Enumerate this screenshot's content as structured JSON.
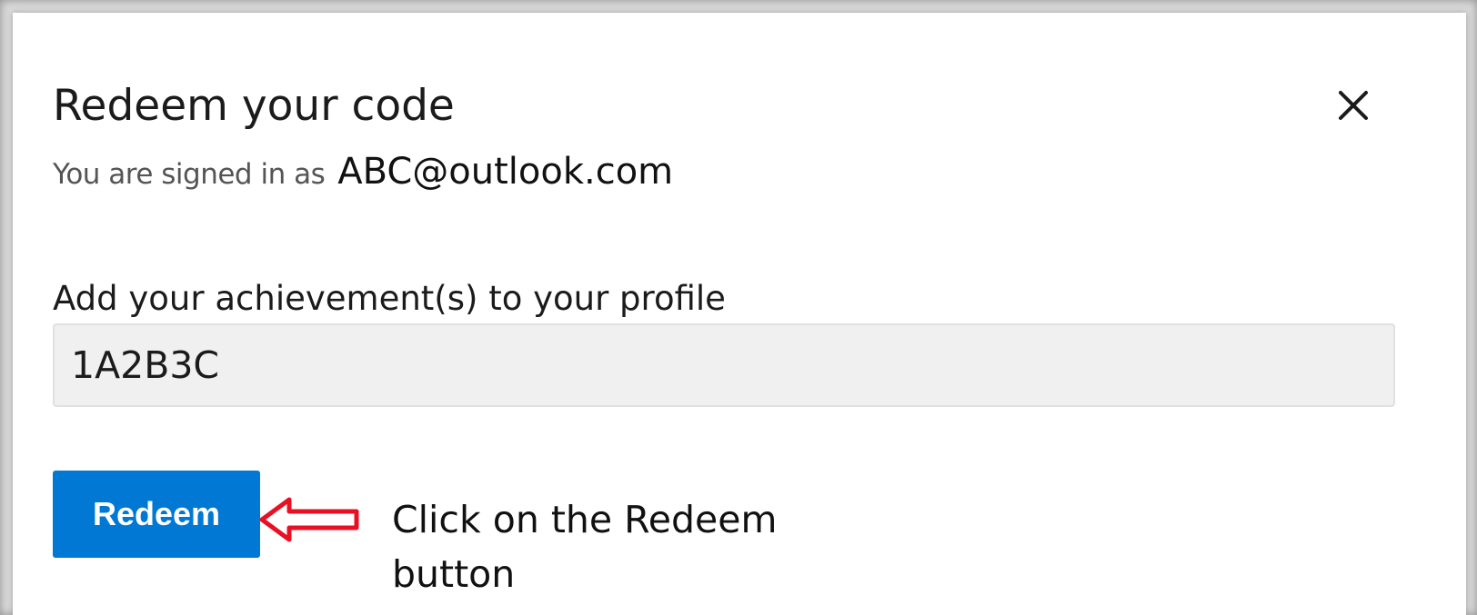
{
  "dialog": {
    "title": "Redeem your code",
    "close_icon": "close-icon",
    "signed_in_label": "You are signed in as",
    "signed_in_email": "ABC@outlook.com",
    "field_label": "Add your achievement(s) to your profile",
    "code_value": "1A2B3C",
    "redeem_label": "Redeem"
  },
  "annotation": {
    "text": "Click on the Redeem button",
    "arrow_icon": "left-arrow-icon",
    "arrow_color": "#e81123"
  },
  "colors": {
    "accent": "#0078d4",
    "input_bg": "#f0f0f0"
  }
}
